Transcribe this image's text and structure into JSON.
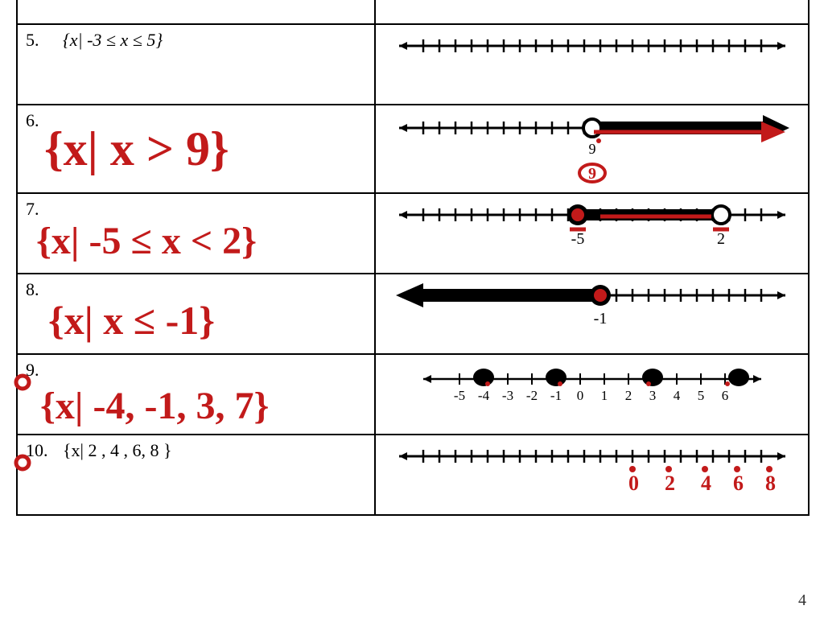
{
  "rows": [
    {
      "num": "5.",
      "printed": "{x| -3 ≤ x ≤ 5}",
      "hand": ""
    },
    {
      "num": "6.",
      "printed": "",
      "hand": "{x| x > 9}"
    },
    {
      "num": "7.",
      "printed": "",
      "hand": "{x| -5 ≤ x < 2}"
    },
    {
      "num": "8.",
      "printed": "",
      "hand": "{x| x ≤ -1}"
    },
    {
      "num": "9.",
      "printed": "",
      "hand": "{x| -4, -1, 3, 7}"
    },
    {
      "num": "10.",
      "printed": "{x| 2 , 4 , 6, 8 }",
      "hand": ""
    }
  ],
  "numberlines": {
    "row6": {
      "open_at": "9",
      "arrow_right": true,
      "hand_label_below": "9"
    },
    "row7": {
      "closed_at": "-5",
      "open_at": "2",
      "segment": true
    },
    "row8": {
      "closed_at": "-1",
      "arrow_left": true
    },
    "row9": {
      "ticks_labeled": [
        "-5",
        "-4",
        "-3",
        "-2",
        "-1",
        "0",
        "1",
        "2",
        "3",
        "4",
        "5",
        "6"
      ],
      "closed_dots": [
        "-4",
        "-1",
        "3",
        "7"
      ]
    },
    "row10": {
      "hand_labels_below": [
        "0",
        "2",
        "4",
        "6",
        "8"
      ]
    }
  },
  "page_number": "4",
  "colors": {
    "ink": "#c21a1a",
    "print": "#000000"
  }
}
